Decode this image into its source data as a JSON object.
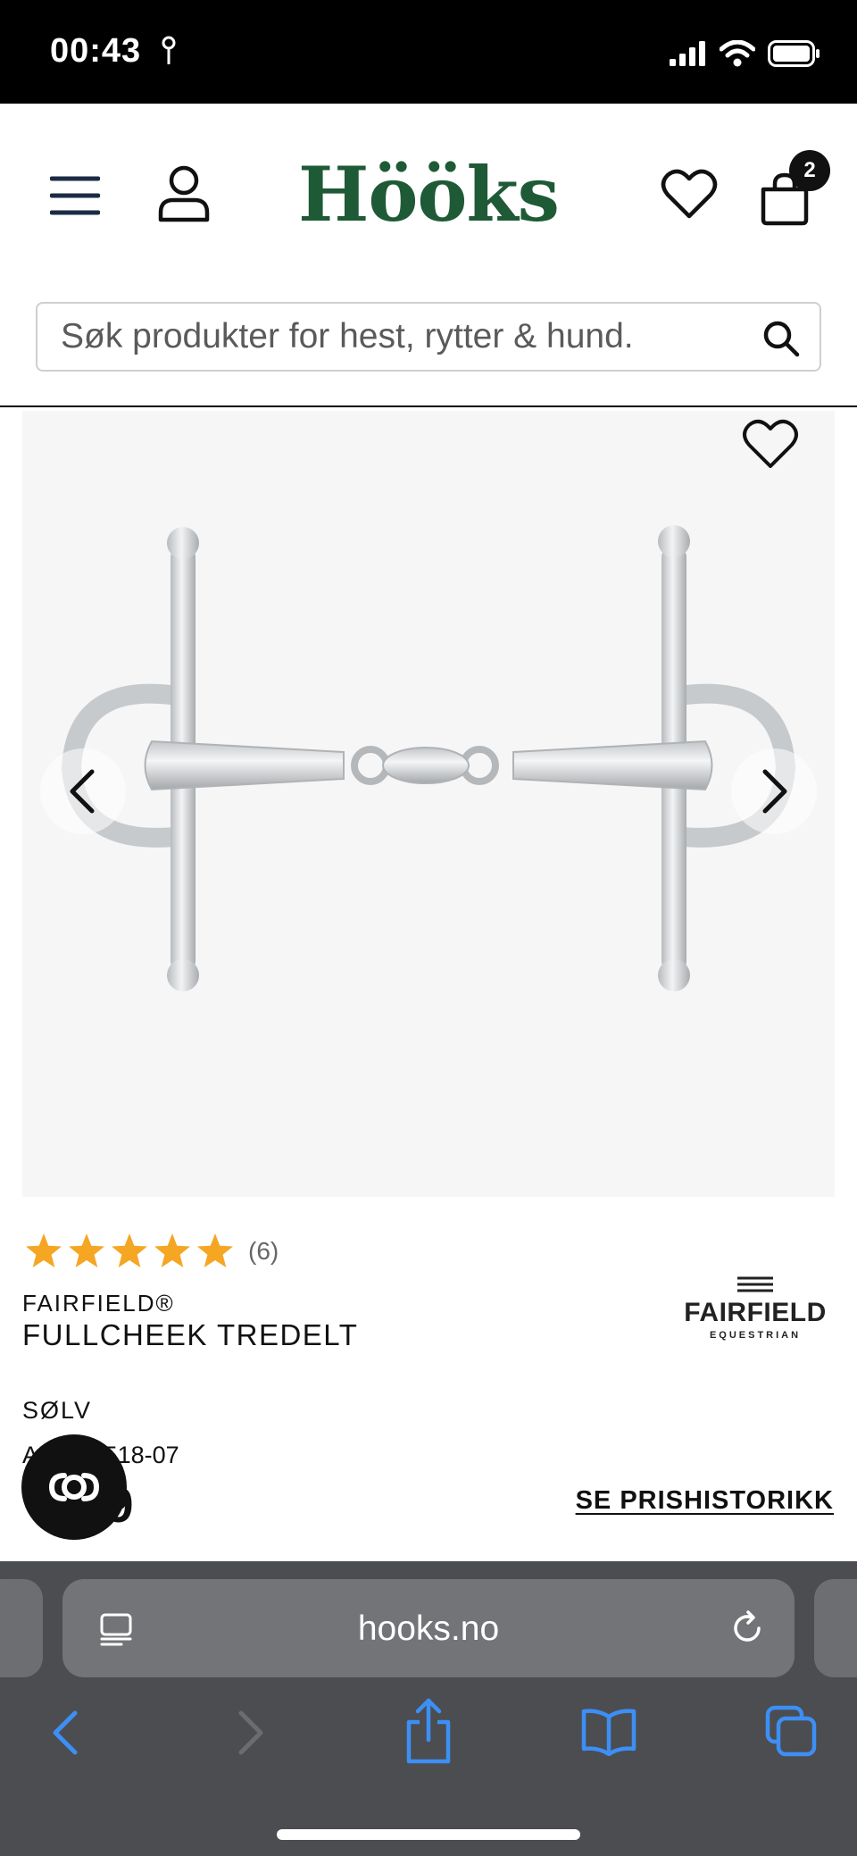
{
  "status_bar": {
    "time": "00:43",
    "icons": [
      "location-icon",
      "cellular-signal-icon",
      "wifi-icon",
      "battery-icon"
    ]
  },
  "header": {
    "logo": "Hööks",
    "cart_count": "2",
    "icons": [
      "menu-icon",
      "account-icon",
      "heart-icon",
      "cart-icon"
    ],
    "search": {
      "placeholder": "Søk produkter for hest, rytter & hund."
    }
  },
  "gallery": {
    "image_alt": "Fullcheek tredelt bit",
    "icons": [
      "favorite-icon",
      "chevron-left-icon",
      "chevron-right-icon"
    ]
  },
  "product": {
    "rating": 5,
    "rating_count": "(6)",
    "brand": "FAIRFIELD®",
    "name": "FULLCHEEK TREDELT",
    "brand_logo": {
      "name": "FAIRFIELD",
      "sub": "EQUESTRIAN"
    },
    "color": "SØLV",
    "article_number": "A      00518-07",
    "price": "      9",
    "price_history_link": "SE PRISHISTORIKK",
    "star_color": "#f5a623"
  },
  "browser": {
    "url": "hooks.no",
    "accent_color": "#3d8ff5",
    "toolbar_icons": [
      "back-icon",
      "forward-icon",
      "share-icon",
      "bookmarks-icon",
      "tabs-icon"
    ]
  },
  "colors": {
    "brand_green": "#1e5a36",
    "browser_bg": "#4b4d51"
  }
}
